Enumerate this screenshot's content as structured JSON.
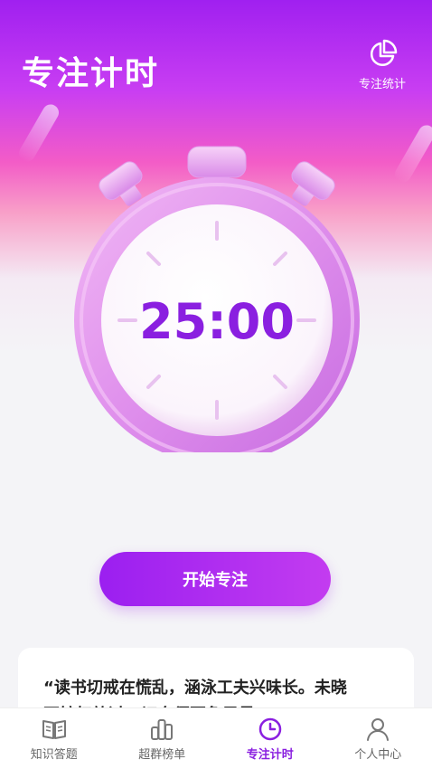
{
  "header": {
    "title": "专注计时",
    "stats_label": "专注统计"
  },
  "timer": {
    "display": "25:00"
  },
  "start_button": "开始专注",
  "quote": {
    "line1": "“读书切戒在慌乱，涵泳工夫兴味长。未晓",
    "line2": "不妨权放过，切身须要急思量。”"
  },
  "tabs": [
    {
      "label": "知识答题",
      "icon": "book-icon",
      "active": false
    },
    {
      "label": "超群榜单",
      "icon": "ranking-icon",
      "active": false
    },
    {
      "label": "专注计时",
      "icon": "clock-icon",
      "active": true
    },
    {
      "label": "个人中心",
      "icon": "user-icon",
      "active": false
    }
  ],
  "colors": {
    "accent": "#8a1fe0",
    "timer_text": "#8a1fe0",
    "clock_body": "#e9a7f0"
  }
}
